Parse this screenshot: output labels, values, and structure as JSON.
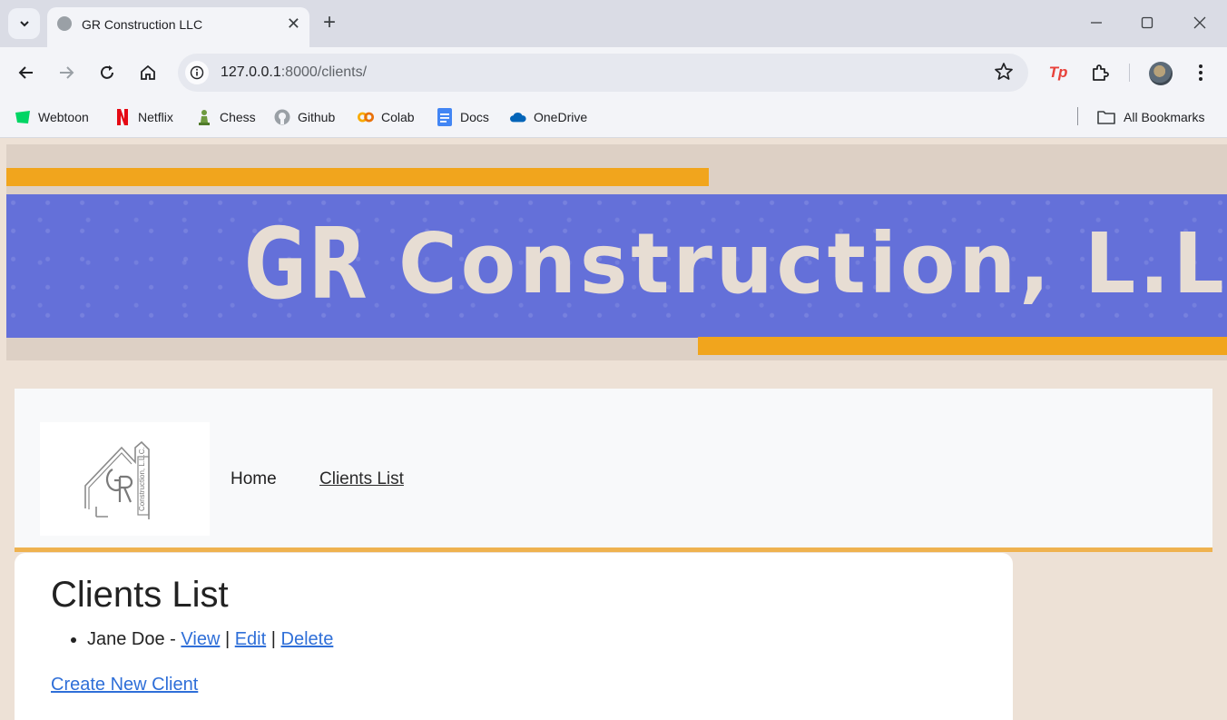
{
  "browser": {
    "tab_title": "GR Construction LLC",
    "tab_close": "✕",
    "new_tab": "+",
    "url_host": "127.0.0.1",
    "url_path": ":8000/clients/",
    "extension_tp": "Tp",
    "bookmarks": [
      {
        "label": "Webtoon",
        "icon": "webtoon-icon",
        "color": "#00d564"
      },
      {
        "label": "Netflix",
        "icon": "netflix-icon",
        "color": "#e50914"
      },
      {
        "label": "Chess",
        "icon": "chess-icon",
        "color": "#6e9a3f"
      },
      {
        "label": "Github",
        "icon": "github-icon",
        "color": "#9aa0a6"
      },
      {
        "label": "Colab",
        "icon": "colab-icon",
        "color": "#f9ab00"
      },
      {
        "label": "Docs",
        "icon": "docs-icon",
        "color": "#4285f4"
      },
      {
        "label": "OneDrive",
        "icon": "onedrive-icon",
        "color": "#0364b8"
      }
    ],
    "all_bookmarks": "All Bookmarks"
  },
  "banner": {
    "logo_letters": "GR",
    "company_name": "Construction, L.L.C."
  },
  "nav": {
    "logo_letters": "GR",
    "logo_subtext": "Construction, L.L.C.",
    "home": "Home",
    "clients_list": "Clients List"
  },
  "main": {
    "title": "Clients List",
    "clients": [
      {
        "name": "Jane Doe",
        "separator": " - ",
        "view": "View",
        "edit": "Edit",
        "delete": "Delete",
        "pipe": " | "
      }
    ],
    "create_link": "Create New Client"
  },
  "colors": {
    "banner_blue": "#6470d9",
    "banner_orange": "#f1a51d",
    "nav_border": "#efb24f",
    "link": "#2f6fd8"
  }
}
